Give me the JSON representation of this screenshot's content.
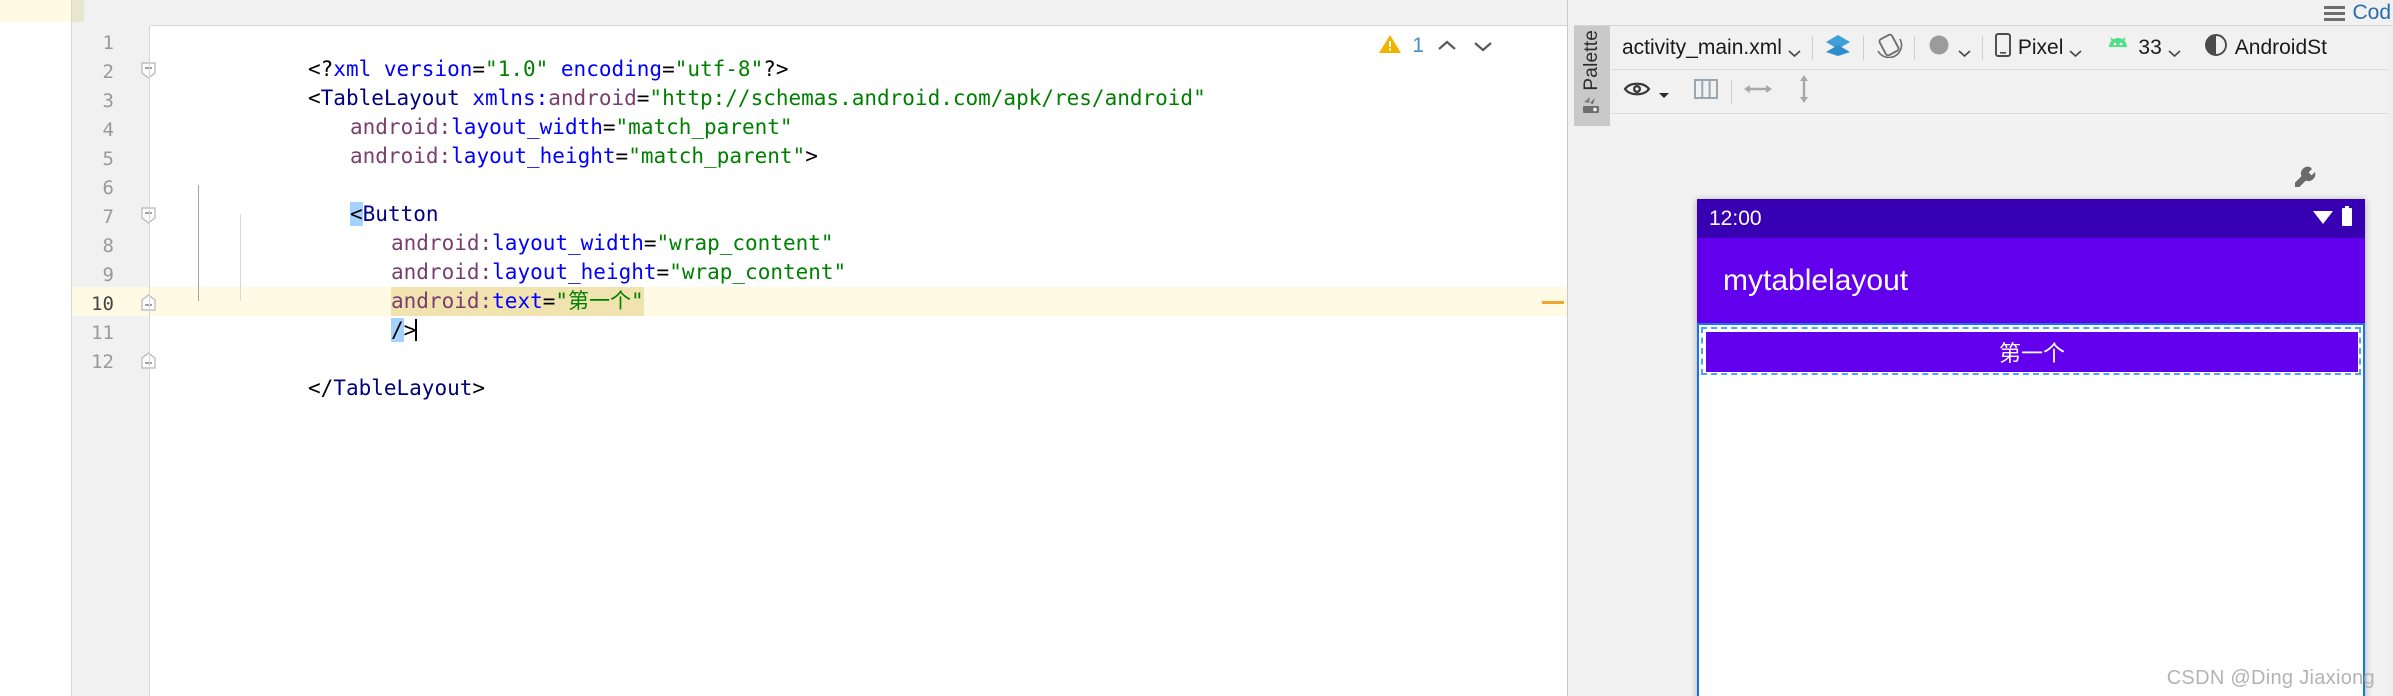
{
  "editor": {
    "inspection": {
      "warning_icon": "warning-triangle-icon",
      "warning_count": "1",
      "prev_icon": "chevron-up-icon",
      "next_icon": "chevron-down-icon"
    },
    "lines": [
      {
        "no": "1",
        "text": "<?xml version=\"1.0\" encoding=\"utf-8\"?>"
      },
      {
        "no": "2",
        "text": "<TableLayout xmlns:android=\"http://schemas.android.com/apk/res/android\""
      },
      {
        "no": "3",
        "text": "    android:layout_width=\"match_parent\""
      },
      {
        "no": "4",
        "text": "    android:layout_height=\"match_parent\">"
      },
      {
        "no": "5",
        "text": ""
      },
      {
        "no": "6",
        "text": "    <Button"
      },
      {
        "no": "7",
        "text": "        android:layout_width=\"wrap_content\""
      },
      {
        "no": "8",
        "text": "        android:layout_height=\"wrap_content\""
      },
      {
        "no": "9",
        "text": "        android:text=\"第一个\""
      },
      {
        "no": "10",
        "text": "        />"
      },
      {
        "no": "11",
        "text": ""
      },
      {
        "no": "12",
        "text": "</TableLayout>"
      }
    ],
    "tokens": {
      "l1": {
        "b1": "<?",
        "kw": "xml",
        "a1": " version",
        "eq1": "=",
        "v1": "\"1.0\"",
        "a2": " encoding",
        "eq2": "=",
        "v2": "\"utf-8\"",
        "b2": "?>"
      },
      "l2": {
        "b1": "<",
        "tag": "TableLayout",
        "ns": " xmlns:",
        "attr": "android",
        "eq": "=",
        "val": "\"http://schemas.android.com/apk/res/android\""
      },
      "l3": {
        "ns": "android:",
        "attr": "layout_width",
        "eq": "=",
        "val": "\"match_parent\""
      },
      "l4": {
        "ns": "android:",
        "attr": "layout_height",
        "eq": "=",
        "val": "\"match_parent\"",
        "b": ">"
      },
      "l6": {
        "b1": "<",
        "tag": "Button"
      },
      "l7": {
        "ns": "android:",
        "attr": "layout_width",
        "eq": "=",
        "val": "\"wrap_content\""
      },
      "l8": {
        "ns": "android:",
        "attr": "layout_height",
        "eq": "=",
        "val": "\"wrap_content\""
      },
      "l9": {
        "ns": "android:",
        "attr": "text",
        "eq": "=",
        "val": "\"第一个\""
      },
      "l10": {
        "slash": "/",
        "gt": ">"
      },
      "l12": {
        "b1": "</",
        "tag": "TableLayout",
        "b2": ">"
      }
    }
  },
  "design": {
    "view_mode": {
      "label": "Cod",
      "menu_icon": "hamburger-icon"
    },
    "palette": {
      "label": "Palette",
      "icon": "palette-icon"
    },
    "toolbar": {
      "file_name": "activity_main.xml",
      "file_chevron": "chevron-down-icon",
      "design_surface_icon": "layers-icon",
      "orientation_icon": "rotate-screen-icon",
      "theme_icon": "theme-contrast-icon",
      "device_icon": "phone-icon",
      "device_name": "Pixel",
      "device_chevron": "chevron-down-icon",
      "api_icon": "android-robot-icon",
      "api_level": "33",
      "api_chevron": "chevron-down-icon",
      "appearance_icon": "contrast-circle-icon",
      "appearance_name": "AndroidSt"
    },
    "toolbar2": {
      "visibility_icon": "eye-icon",
      "visibility_chevron": "chevron-down-icon",
      "panels_icon": "columns-icon",
      "width_icon": "arrows-horizontal-icon",
      "height_icon": "arrows-vertical-icon"
    },
    "canvas": {
      "design_attrs_icon": "wrench-icon",
      "device_preview": {
        "status_time": "12:00",
        "wifi_icon": "wifi-icon",
        "battery_icon": "battery-icon",
        "app_title": "mytablelayout",
        "button_label": "第一个"
      }
    },
    "watermark": "CSDN @Ding Jiaxiong"
  },
  "colors": {
    "app_bar_purple": "#6200ee",
    "status_bar_purple": "#3700b3",
    "selection_blue": "#a6d2ff",
    "caret_line": "#fffae3",
    "occurrence": "#f0e3b0",
    "warning_yellow": "#f0b400",
    "string_green": "#008000",
    "attr_blue": "#0000ff",
    "tag_navy": "#000080",
    "ns_purple": "#7a3e6e"
  }
}
